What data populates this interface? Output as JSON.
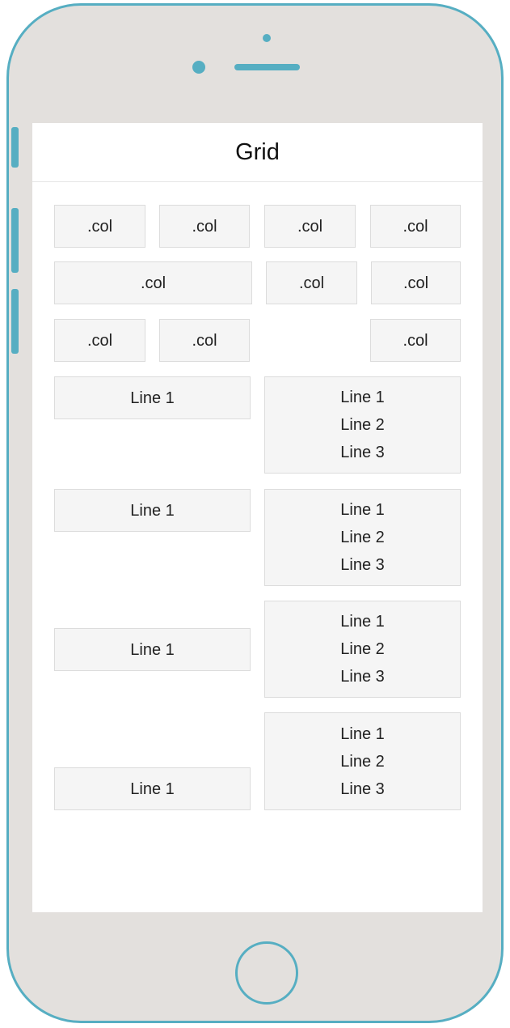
{
  "navbar": {
    "title": "Grid"
  },
  "row1": [
    ".col",
    ".col",
    ".col",
    ".col"
  ],
  "row2": [
    ".col",
    ".col",
    ".col"
  ],
  "row3": [
    ".col",
    ".col",
    ".col"
  ],
  "line_rows": [
    {
      "left": "Line 1",
      "right": [
        "Line 1",
        "Line 2",
        "Line 3"
      ]
    },
    {
      "left": "Line 1",
      "right": [
        "Line 1",
        "Line 2",
        "Line 3"
      ]
    },
    {
      "left": "Line 1",
      "right": [
        "Line 1",
        "Line 2",
        "Line 3"
      ]
    },
    {
      "left": "Line 1",
      "right": [
        "Line 1",
        "Line 2",
        "Line 3"
      ]
    }
  ],
  "icons": {
    "camera": "camera-icon",
    "sensor": "sensor-icon",
    "speaker": "speaker-grille",
    "home": "home-button"
  },
  "colors": {
    "frame": "#56aec2",
    "body": "#e3e0dd",
    "cell_bg": "#f5f5f5"
  }
}
